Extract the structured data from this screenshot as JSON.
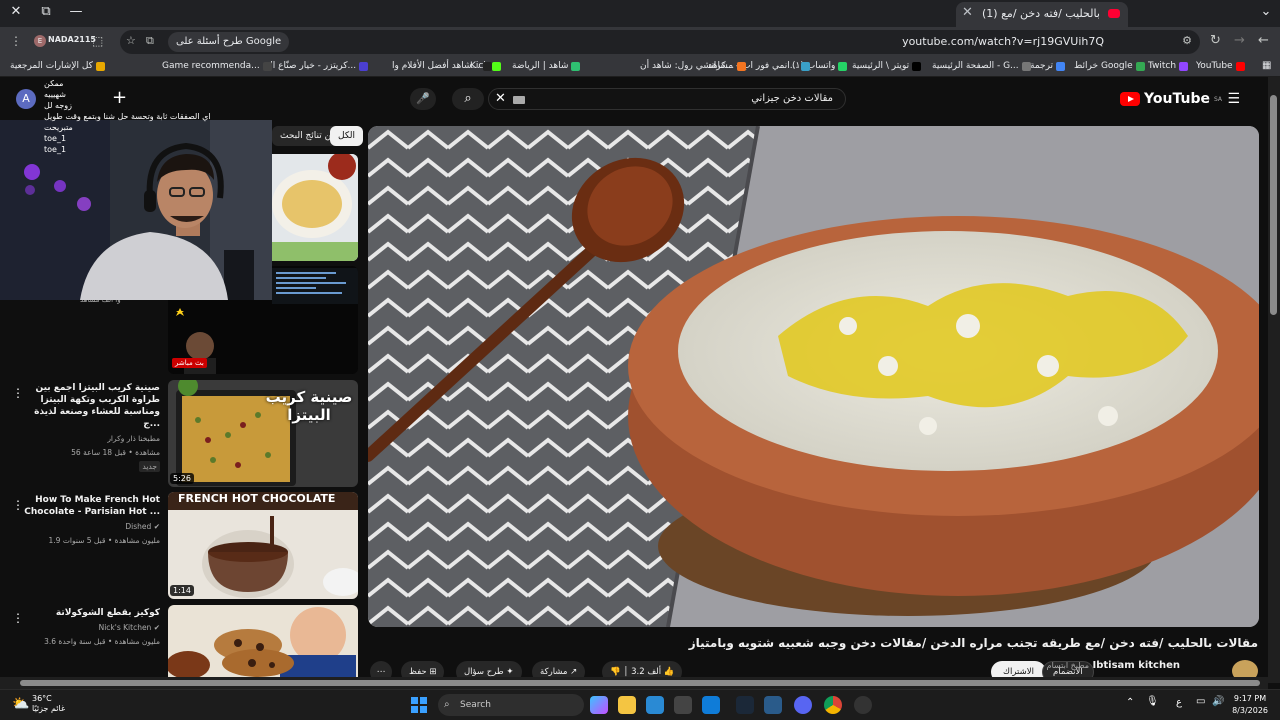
{
  "browser": {
    "tab_title": "(1) مقالات بالحليب /فته دخن /مع",
    "url": "youtube.com/watch?v=rj19GVUih7Q",
    "ai_chip": "طرح أسئلة على Google",
    "profile_chip": "NADA2115"
  },
  "bookmarks": [
    {
      "label": "YouTube",
      "color": "#ff0000"
    },
    {
      "label": "Twitch",
      "color": "#9146ff"
    },
    {
      "label": "خرائط Google",
      "color": "#34a853"
    },
    {
      "label": "ترجمة",
      "color": "#4285f4"
    },
    {
      "label": "الصفحة الرئيسية - G...",
      "color": "#777777"
    },
    {
      "label": "تويتر \\ الرئيسية",
      "color": "#000000"
    },
    {
      "label": "(١) واتساب",
      "color": "#25d366"
    },
    {
      "label": "انمي فور اب - مشاهد...",
      "color": "#3aa0c8"
    },
    {
      "label": "كرانشي رول: شاهد أن...",
      "color": "#f47521"
    },
    {
      "label": "شاهد | الرياضة",
      "color": "#2fbf71"
    },
    {
      "label": "Kick",
      "color": "#53fc18"
    },
    {
      "label": "شاهد أفضل الأفلام وا...",
      "color": "#222222"
    },
    {
      "label": "كريتزر - خيار صنّاع الم...",
      "color": "#4b3fd1"
    },
    {
      "label": "Game recommenda...",
      "color": "#444444"
    },
    {
      "label": "كل الإشارات المرجعية",
      "color": "#e8a800"
    }
  ],
  "header": {
    "logo": "YouTube",
    "region": "SA",
    "search_query": "مقالات دخن جيزاني",
    "avatar_letter": "A"
  },
  "overlay": {
    "chat_lines": [
      "ممكن",
      "شهيييه",
      "زوجه لل",
      "اي الصفقات ثابة وتحسة حل شنا وبتمع وقت طويل",
      "متبريحت",
      "toe_1",
      "toe_1"
    ]
  },
  "chips": {
    "all": "الكل",
    "channel": "من تنائج البحث"
  },
  "related": [
    {
      "title": "صينية كريب البيتزا اجمع بين طراوة الكريب وتكهة البيتزا ومناسبة للعشاء وصنعة لذيذة ج...",
      "channel": "مطبخنا ذار وكرار",
      "stats": "56 مشاهدة • قبل 18 ساعة",
      "badge": "جديد",
      "duration": "5:26",
      "thumb_text": "صينية كريب البيتزا"
    },
    {
      "title": "How To Make French Hot Chocolate - Parisian Hot ...",
      "channel": "Dished",
      "stats": "1.9 مليون مشاهدة • قبل 5 سنوات",
      "duration": "1:14",
      "thumb_text": "FRENCH HOT CHOCOLATE"
    },
    {
      "title": "كوكيز بقطع الشوكولاتة",
      "channel": "Nick's Kitchen",
      "stats": "3.6 مليون مشاهدة • قبل سنة واحدة"
    }
  ],
  "live_thumb": {
    "label": "بث مباشر",
    "meta": "وا ألف مشاهد"
  },
  "video": {
    "title": "مقالات بالحليب /فته دخن /مع طريقه تجنب مراره الدخن /مقالات دخن وجبه شعبيه شتويه وبامتياز",
    "channel": "Ibtisam kitchen",
    "channel_ar": "مطبخ ابتسام",
    "subscribe": "الاشتراك",
    "join": "الانضمام",
    "likes": "3.2 ألف",
    "share": "مشاركة",
    "ask": "طرح سؤال",
    "save": "حفظ"
  },
  "taskbar": {
    "temp": "36°C",
    "weather": "غائم جزئيًا",
    "search": "Search",
    "lang": "ع",
    "time": "9:17 PM",
    "date": "8/3/2026"
  }
}
